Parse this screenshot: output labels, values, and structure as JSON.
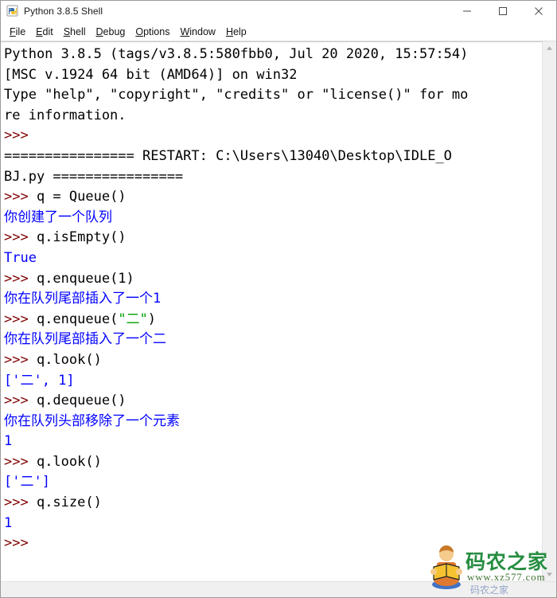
{
  "window": {
    "title": "Python 3.8.5 Shell",
    "icon": "python-idle-icon",
    "controls": {
      "minimize": "minimize-icon",
      "maximize": "maximize-icon",
      "close": "close-icon"
    }
  },
  "menubar": {
    "items": [
      {
        "label": "File",
        "mnemonic": "F",
        "rest": "ile"
      },
      {
        "label": "Edit",
        "mnemonic": "E",
        "rest": "dit"
      },
      {
        "label": "Shell",
        "mnemonic": "S",
        "rest": "hell"
      },
      {
        "label": "Debug",
        "mnemonic": "D",
        "rest": "ebug"
      },
      {
        "label": "Options",
        "mnemonic": "O",
        "rest": "ptions"
      },
      {
        "label": "Window",
        "mnemonic": "W",
        "rest": "indow"
      },
      {
        "label": "Help",
        "mnemonic": "H",
        "rest": "elp"
      }
    ]
  },
  "colors": {
    "prompt": "#7f0000",
    "stdout": "#0000ff",
    "string": "#00a000",
    "text": "#000000",
    "background": "#ffffff",
    "scrollbar": "#f0f0f0"
  },
  "shell": {
    "lines": [
      {
        "segments": [
          {
            "text": "Python 3.8.5 (tags/v3.8.5:580fbb0, Jul 20 2020, 15:57:54)",
            "style": "plain"
          }
        ]
      },
      {
        "segments": [
          {
            "text": "[MSC v.1924 64 bit (AMD64)] on win32",
            "style": "plain"
          }
        ]
      },
      {
        "segments": [
          {
            "text": "Type \"help\", \"copyright\", \"credits\" or \"license()\" for mo",
            "style": "plain"
          }
        ]
      },
      {
        "segments": [
          {
            "text": "re information.",
            "style": "plain"
          }
        ]
      },
      {
        "segments": [
          {
            "text": ">>> ",
            "style": "prompt"
          }
        ]
      },
      {
        "segments": [
          {
            "text": "================ RESTART: C:\\Users\\13040\\Desktop\\IDLE_O",
            "style": "plain"
          }
        ]
      },
      {
        "segments": [
          {
            "text": "BJ.py ================",
            "style": "plain"
          }
        ]
      },
      {
        "segments": [
          {
            "text": ">>> ",
            "style": "prompt"
          },
          {
            "text": "q = Queue()",
            "style": "plain"
          }
        ]
      },
      {
        "segments": [
          {
            "text": "你创建了一个队列",
            "style": "stdout"
          }
        ]
      },
      {
        "segments": [
          {
            "text": ">>> ",
            "style": "prompt"
          },
          {
            "text": "q.isEmpty()",
            "style": "plain"
          }
        ]
      },
      {
        "segments": [
          {
            "text": "True",
            "style": "stdout"
          }
        ]
      },
      {
        "segments": [
          {
            "text": ">>> ",
            "style": "prompt"
          },
          {
            "text": "q.enqueue(1)",
            "style": "plain"
          }
        ]
      },
      {
        "segments": [
          {
            "text": "你在队列尾部插入了一个1",
            "style": "stdout"
          }
        ]
      },
      {
        "segments": [
          {
            "text": ">>> ",
            "style": "prompt"
          },
          {
            "text": "q.enqueue(",
            "style": "plain"
          },
          {
            "text": "\"二\"",
            "style": "string"
          },
          {
            "text": ")",
            "style": "plain"
          }
        ]
      },
      {
        "segments": [
          {
            "text": "你在队列尾部插入了一个二",
            "style": "stdout"
          }
        ]
      },
      {
        "segments": [
          {
            "text": ">>> ",
            "style": "prompt"
          },
          {
            "text": "q.look()",
            "style": "plain"
          }
        ]
      },
      {
        "segments": [
          {
            "text": "['二', 1]",
            "style": "stdout"
          }
        ]
      },
      {
        "segments": [
          {
            "text": ">>> ",
            "style": "prompt"
          },
          {
            "text": "q.dequeue()",
            "style": "plain"
          }
        ]
      },
      {
        "segments": [
          {
            "text": "你在队列头部移除了一个元素",
            "style": "stdout"
          }
        ]
      },
      {
        "segments": [
          {
            "text": "1",
            "style": "stdout"
          }
        ]
      },
      {
        "segments": [
          {
            "text": ">>> ",
            "style": "prompt"
          },
          {
            "text": "q.look()",
            "style": "plain"
          }
        ]
      },
      {
        "segments": [
          {
            "text": "['二']",
            "style": "stdout"
          }
        ]
      },
      {
        "segments": [
          {
            "text": ">>> ",
            "style": "prompt"
          },
          {
            "text": "q.size()",
            "style": "plain"
          }
        ]
      },
      {
        "segments": [
          {
            "text": "1",
            "style": "stdout"
          }
        ]
      },
      {
        "segments": [
          {
            "text": ">>> ",
            "style": "prompt"
          }
        ]
      }
    ]
  },
  "watermark": {
    "brand": "码农之家",
    "url": "www.xz577.com",
    "sub": "码农之家"
  }
}
